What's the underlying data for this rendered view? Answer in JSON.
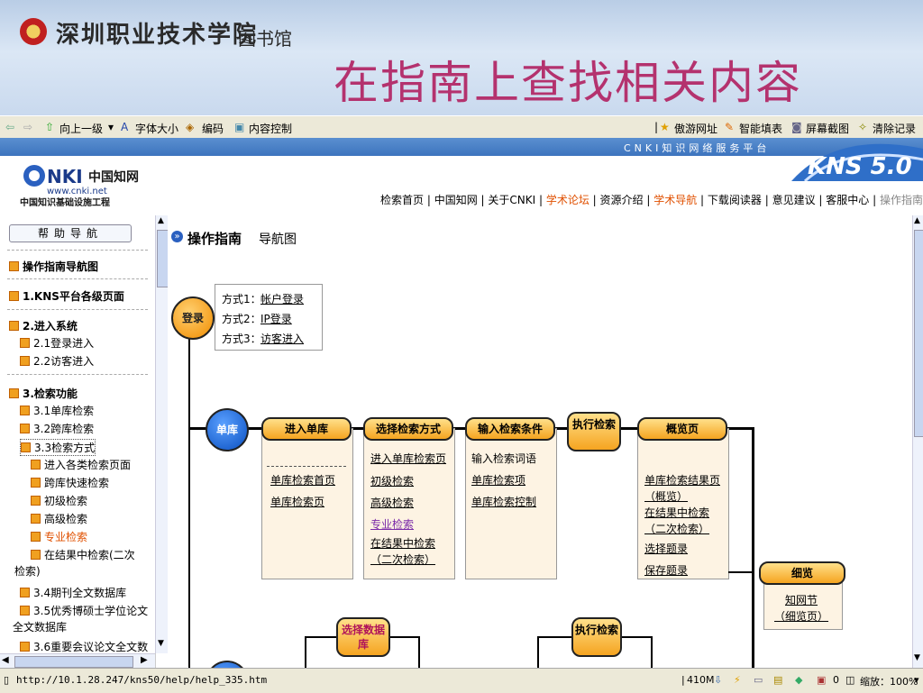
{
  "banner": {
    "school": "深圳职业技术学院",
    "library": "图书馆",
    "slide_title": "在指南上查找相关内容"
  },
  "ie_toolbar": {
    "up": "向上一级",
    "font": "字体大小",
    "encoding": "编码",
    "content": "内容控制",
    "fav": "傲游网址",
    "fill": "智能填表",
    "shot": "屏幕截图",
    "clear": "清除记录"
  },
  "kns": {
    "platform": "CNKI知识网络服务平台",
    "version": "KNS 5.0",
    "cnki_url": "www.cnki.net",
    "cnki_cn": "中国知识基础设施工程"
  },
  "nav": {
    "items": [
      "检索首页",
      "中国知网",
      "关于CNKI",
      "学术论坛",
      "资源介绍",
      "学术导航",
      "下载阅读器",
      "意见建议",
      "客服中心",
      "操作指南"
    ]
  },
  "toc": {
    "help_nav": "帮助导航",
    "items": [
      "操作指南导航图",
      "1.KNS平台各级页面",
      "2.进入系统",
      "2.1登录进入",
      "2.2访客进入",
      "3.检索功能",
      "3.1单库检索",
      "3.2跨库检索",
      "3.3检索方式",
      "进入各类检索页面",
      "跨库快速检索",
      "初级检索",
      "高级检索",
      "专业检索",
      "在结果中检索(二次",
      "检索)",
      "3.4期刊全文数据库",
      "3.5优秀博硕士学位论文",
      "全文数据库",
      "3.6重要会议论文全文数"
    ]
  },
  "content": {
    "title": "操作指南",
    "subtitle": "导航图",
    "login": "登录",
    "login_opts": [
      "方式1：",
      "帐户登录",
      "方式2：",
      "IP登录",
      "方式3：",
      "访客进入"
    ],
    "single_lib": "单库",
    "headers": [
      "进入单库",
      "选择检索方式",
      "输入检索条件",
      "执行检索",
      "概览页"
    ],
    "col1": [
      "单库检索首页",
      "单库检索页"
    ],
    "col2": [
      "进入单库检索页",
      "初级检索",
      "高级检索",
      "专业检索",
      "在结果中检索",
      "（二次检索）"
    ],
    "col3": [
      "输入检索词语",
      "单库检索项",
      "单库检索控制"
    ],
    "col5": [
      "单库检索结果页",
      "（概览）",
      "在结果中检索",
      "（二次检索）",
      "选择题录",
      "保存题录"
    ],
    "detail": "细览",
    "detail_links": [
      "知网节",
      "（细览页）"
    ],
    "choose_db": "选择数据库",
    "exec2": "执行检索"
  },
  "status": {
    "url": "http://10.1.28.247/kns50/help/help_335.htm",
    "mem": "410M",
    "popup": "0",
    "zoom_label": "缩放：100%"
  }
}
